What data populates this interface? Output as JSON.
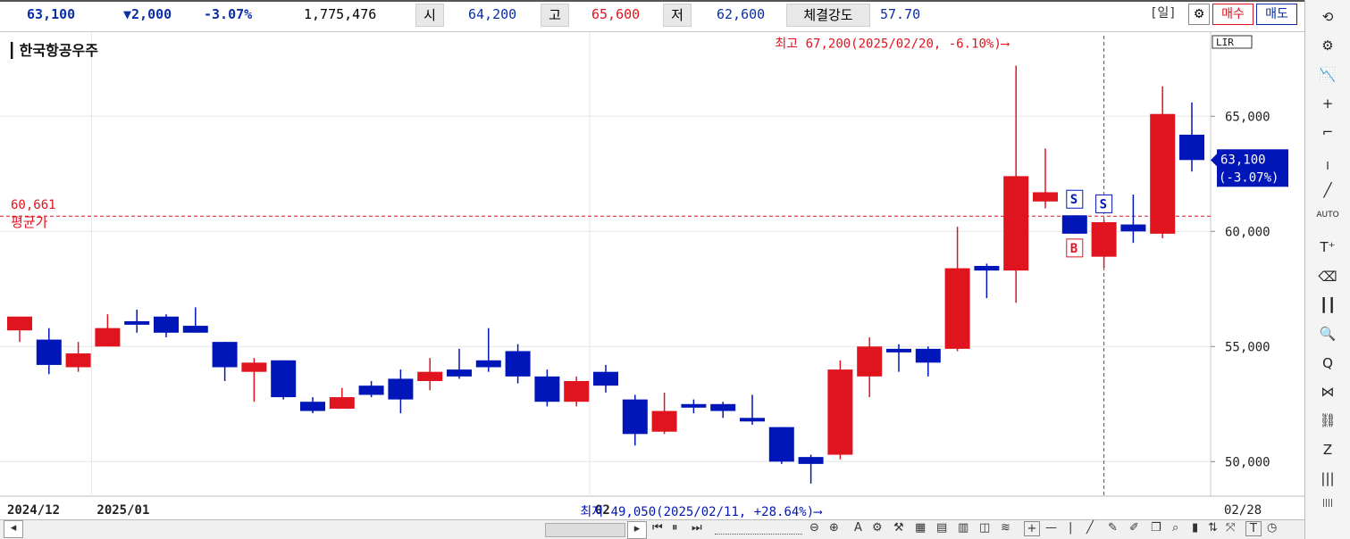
{
  "quote": {
    "price": "63,100",
    "change": "▼2,000",
    "rate": "-3.07%",
    "volume": "1,775,476",
    "open_label": "시",
    "open": "64,200",
    "high_label": "고",
    "high": "65,600",
    "low_label": "저",
    "low": "62,600",
    "strength_label": "체결강도",
    "strength": "57.70",
    "period": "[일]",
    "buy_label": "매수",
    "sell_label": "매도",
    "lir_label": "LIR"
  },
  "colors": {
    "up": "#e0141e",
    "down": "#0016b8",
    "avg": "#e0141e",
    "grid": "#e6e6e6"
  },
  "chart_data": {
    "type": "candlestick",
    "title": "한국항공우주",
    "ylim": [
      48500,
      68500
    ],
    "y_ticks": [
      50000,
      55000,
      60000,
      65000
    ],
    "y_tick_labels": [
      "50,000",
      "55,000",
      "60,000",
      "65,000"
    ],
    "x_labels": [
      {
        "label": "2024/12",
        "index": 0
      },
      {
        "label": "2025/01",
        "index": 3
      },
      {
        "label": "02",
        "index": 20
      },
      {
        "label": "02/28",
        "index": 40
      }
    ],
    "candles": [
      {
        "o": 55700,
        "h": 56300,
        "l": 55200,
        "c": 56300
      },
      {
        "o": 55300,
        "h": 55800,
        "l": 53800,
        "c": 54200
      },
      {
        "o": 54100,
        "h": 55200,
        "l": 53900,
        "c": 54700
      },
      {
        "o": 55000,
        "h": 56400,
        "l": 55000,
        "c": 55800
      },
      {
        "o": 56100,
        "h": 56600,
        "l": 55600,
        "c": 56000
      },
      {
        "o": 56300,
        "h": 56400,
        "l": 55400,
        "c": 55600
      },
      {
        "o": 55900,
        "h": 56700,
        "l": 55600,
        "c": 55600
      },
      {
        "o": 55200,
        "h": 55200,
        "l": 53500,
        "c": 54100
      },
      {
        "o": 53900,
        "h": 54500,
        "l": 52600,
        "c": 54300
      },
      {
        "o": 54400,
        "h": 54400,
        "l": 52700,
        "c": 52800
      },
      {
        "o": 52600,
        "h": 52800,
        "l": 52100,
        "c": 52200
      },
      {
        "o": 52300,
        "h": 53200,
        "l": 52300,
        "c": 52800
      },
      {
        "o": 53300,
        "h": 53500,
        "l": 52800,
        "c": 52900
      },
      {
        "o": 53600,
        "h": 54000,
        "l": 52100,
        "c": 52700
      },
      {
        "o": 53500,
        "h": 54500,
        "l": 53100,
        "c": 53900
      },
      {
        "o": 54000,
        "h": 54900,
        "l": 53600,
        "c": 53700
      },
      {
        "o": 54400,
        "h": 55800,
        "l": 53900,
        "c": 54100
      },
      {
        "o": 54800,
        "h": 55100,
        "l": 53400,
        "c": 53700
      },
      {
        "o": 53700,
        "h": 54000,
        "l": 52400,
        "c": 52600
      },
      {
        "o": 52600,
        "h": 53700,
        "l": 52400,
        "c": 53500
      },
      {
        "o": 53900,
        "h": 54200,
        "l": 53000,
        "c": 53300
      },
      {
        "o": 52700,
        "h": 52900,
        "l": 50700,
        "c": 51200
      },
      {
        "o": 51300,
        "h": 53000,
        "l": 51200,
        "c": 52200
      },
      {
        "o": 52500,
        "h": 52700,
        "l": 52100,
        "c": 52400
      },
      {
        "o": 52500,
        "h": 52600,
        "l": 51900,
        "c": 52200
      },
      {
        "o": 51900,
        "h": 52900,
        "l": 51600,
        "c": 51800
      },
      {
        "o": 51500,
        "h": 51500,
        "l": 49900,
        "c": 50000
      },
      {
        "o": 50200,
        "h": 50300,
        "l": 49050,
        "c": 49900
      },
      {
        "o": 50300,
        "h": 54400,
        "l": 50100,
        "c": 54000
      },
      {
        "o": 53700,
        "h": 55400,
        "l": 52800,
        "c": 55000
      },
      {
        "o": 54900,
        "h": 55100,
        "l": 53900,
        "c": 54800
      },
      {
        "o": 54900,
        "h": 55000,
        "l": 53700,
        "c": 54300
      },
      {
        "o": 54900,
        "h": 60200,
        "l": 54800,
        "c": 58400
      },
      {
        "o": 58500,
        "h": 58600,
        "l": 57100,
        "c": 58300
      },
      {
        "o": 58300,
        "h": 67200,
        "l": 56900,
        "c": 62400
      },
      {
        "o": 61300,
        "h": 63600,
        "l": 61000,
        "c": 61700
      },
      {
        "o": 60700,
        "h": 60700,
        "l": 59900,
        "c": 59900
      },
      {
        "o": 58900,
        "h": 60500,
        "l": 58400,
        "c": 60400
      },
      {
        "o": 60300,
        "h": 61600,
        "l": 59500,
        "c": 60000
      },
      {
        "o": 59900,
        "h": 66300,
        "l": 59700,
        "c": 65100
      },
      {
        "o": 64200,
        "h": 65600,
        "l": 62600,
        "c": 63100
      }
    ],
    "average_price": 60661,
    "average_label": "60,661",
    "average_name": "평균가",
    "last_value_label": "63,100",
    "last_rate_label": "(-3.07%)",
    "high_annotation": "최고 67,200(2025/02/20, -6.10%)⟶",
    "low_annotation": "최저 49,050(2025/02/11, +28.64%)⟶",
    "signals": [
      {
        "index": 36,
        "label": "S",
        "type": "sell"
      },
      {
        "index": 37,
        "label": "S",
        "type": "sell"
      },
      {
        "index": 36,
        "label": "B",
        "type": "buy"
      }
    ],
    "crosshair_index": 37
  },
  "toolbar_right": [
    {
      "name": "refresh-icon",
      "glyph": "⟲"
    },
    {
      "name": "settings-icon",
      "glyph": "⚙"
    },
    {
      "name": "indicator-icon",
      "glyph": "📉"
    },
    {
      "name": "crosshair-add-icon",
      "glyph": "+"
    },
    {
      "name": "hline-icon",
      "glyph": "⌐"
    },
    {
      "name": "vline-icon",
      "glyph": "╷"
    },
    {
      "name": "trendline-icon",
      "glyph": "╱"
    },
    {
      "name": "auto-icon",
      "glyph": "AUTO"
    },
    {
      "name": "text-icon",
      "glyph": "T⁺"
    },
    {
      "name": "all-delete-icon",
      "glyph": "⌫"
    },
    {
      "name": "candle-icon",
      "glyph": "┃┃"
    },
    {
      "name": "zoom-in-icon",
      "glyph": "🔍"
    },
    {
      "name": "zoom-list-icon",
      "glyph": "Q"
    },
    {
      "name": "compare-icon",
      "glyph": "⋈"
    },
    {
      "name": "pattern-icon",
      "glyph": "⛓"
    },
    {
      "name": "zigzag-icon",
      "glyph": "Z"
    },
    {
      "name": "bars-icon",
      "glyph": "|||"
    },
    {
      "name": "bars2-icon",
      "glyph": "||||"
    }
  ]
}
